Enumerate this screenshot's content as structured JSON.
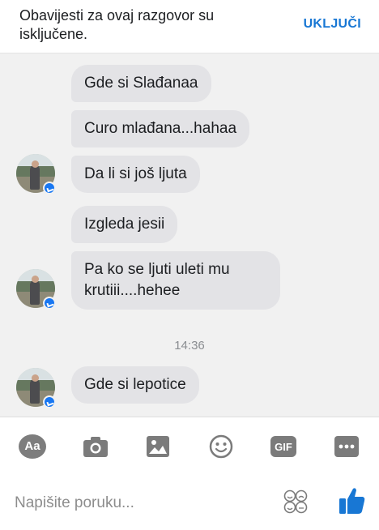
{
  "notice": {
    "text": "Obavijesti za ovaj razgovor su isključene.",
    "action": "UKLJUČI"
  },
  "messages": [
    {
      "text": "Gde si Slađanaa"
    },
    {
      "text": "Curo mlađana...hahaa"
    },
    {
      "text": "Da li si još ljuta"
    },
    {
      "text": "Izgleda jesii"
    },
    {
      "text": "Pa ko se ljuti uleti mu krutiii....hehee"
    },
    {
      "text": "Gde si lepotice"
    }
  ],
  "timestamp": "14:36",
  "toolbar": {
    "icons": [
      "text-format-icon",
      "camera-icon",
      "gallery-icon",
      "emoji-icon",
      "gif-icon",
      "more-icon"
    ],
    "aa_label": "Aa",
    "gif_label": "GIF"
  },
  "composer": {
    "placeholder": "Napišite poruku..."
  },
  "colors": {
    "accent": "#1877d4",
    "bubble": "#e3e3e6",
    "background": "#f1f1f1",
    "icon": "#7b7b7b"
  }
}
